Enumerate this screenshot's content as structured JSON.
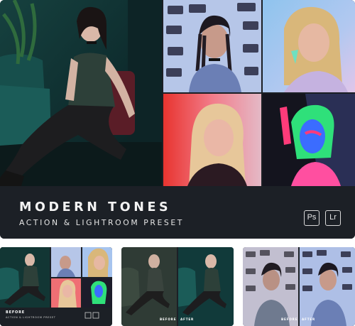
{
  "product": {
    "title": "MODERN TONES",
    "subtitle": "ACTION & LIGHTROOM PRESET",
    "badges": [
      "Ps",
      "Lr"
    ]
  },
  "thumbnails": [
    {
      "label": "BEFORE",
      "sublabel": "ACTION & LIGHTROOM PRESET",
      "badges": [
        "Ps",
        "Lr"
      ]
    },
    {
      "before_label": "BEFORE",
      "after_label": "AFTER"
    },
    {
      "before_label": "BEFORE",
      "after_label": "AFTER"
    }
  ],
  "colors": {
    "banner": "#1c2026",
    "teal_room": "#1f4a4a",
    "neon_pink": "#ff3b7a",
    "neon_blue": "#3b6cff",
    "neon_green": "#2fe07a"
  }
}
